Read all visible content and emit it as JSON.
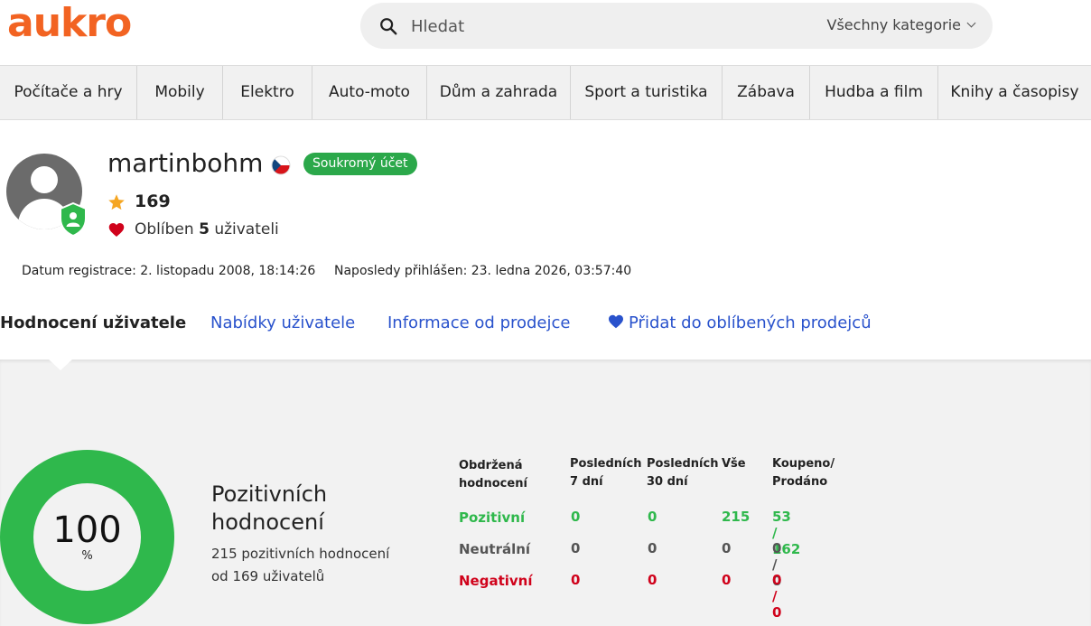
{
  "header": {
    "logo": "aukro",
    "search": {
      "placeholder": "Hledat",
      "category": "Všechny kategorie"
    }
  },
  "categories": [
    "Počítače a hry",
    "Mobily",
    "Elektro",
    "Auto-moto",
    "Dům a zahrada",
    "Sport a turistika",
    "Zábava",
    "Hudba a film",
    "Knihy a časopisy"
  ],
  "profile": {
    "username": "martinbohm",
    "account_type": "Soukromý účet",
    "rating": "169",
    "favorite_prefix": "Oblíben",
    "favorite_count": "5",
    "favorite_suffix": "uživateli",
    "registration": "Datum registrace: 2. listopadu 2008, 18:14:26",
    "last_login": "Naposledy přihlášen: 23. ledna 2026, 03:57:40"
  },
  "tabs": {
    "ratings": "Hodnocení uživatele",
    "offers": "Nabídky uživatele",
    "seller_info": "Informace od prodejce",
    "add_favorite": "Přidat do oblíbených prodejců"
  },
  "summary": {
    "percent": "100",
    "unit": "%",
    "title": "Pozitivních hodnocení",
    "line1": "215 pozitivních hodnocení",
    "line2": "od 169 uživatelů"
  },
  "stats": {
    "headers": [
      "Obdržená hodnocení",
      "Posledních 7 dní",
      "Posledních 30 dní",
      "Vše",
      "Koupeno/ Prodáno"
    ],
    "rows": [
      {
        "label": "Pozitivní",
        "values": [
          "0",
          "0",
          "215",
          "53 / 162"
        ]
      },
      {
        "label": "Neutrální",
        "values": [
          "0",
          "0",
          "0",
          "0 / 0"
        ]
      },
      {
        "label": "Negativní",
        "values": [
          "0",
          "0",
          "0",
          "0 / 0"
        ]
      }
    ]
  },
  "colors": {
    "brand": "#f26322",
    "positive": "#2fb84c",
    "negative": "#d0021b",
    "link": "#2952cc"
  }
}
